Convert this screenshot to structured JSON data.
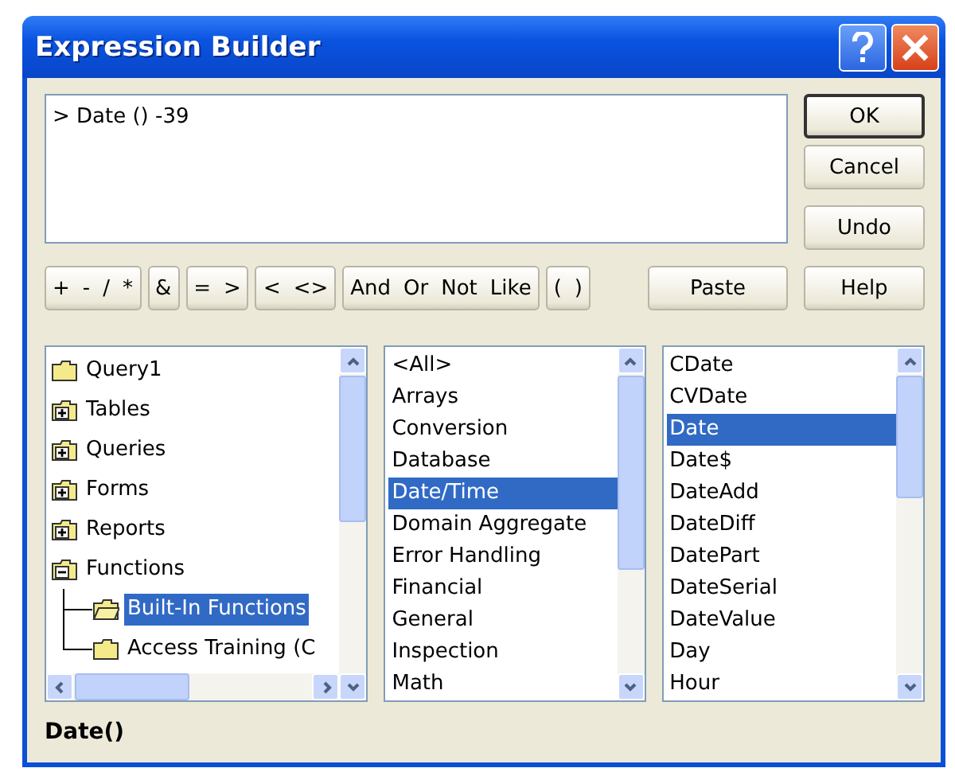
{
  "window": {
    "title": "Expression Builder"
  },
  "expression": "> Date () -39",
  "side_buttons": [
    {
      "label": "OK",
      "default": true
    },
    {
      "label": "Cancel",
      "default": false
    },
    {
      "label": "Undo",
      "default": false
    }
  ],
  "operator_groups": [
    [
      "+",
      "-",
      "/",
      "*"
    ],
    [
      "&"
    ],
    [
      "=",
      ">"
    ],
    [
      "<",
      "<>"
    ],
    [
      "And",
      "Or",
      "Not",
      "Like"
    ],
    [
      "(",
      ")"
    ]
  ],
  "paste_button": "Paste",
  "help_button": "Help",
  "tree": [
    {
      "label": "Query1",
      "selected": false
    },
    {
      "label": "Tables",
      "expanded": false,
      "selected": false
    },
    {
      "label": "Queries",
      "expanded": false,
      "selected": false
    },
    {
      "label": "Forms",
      "expanded": false,
      "selected": false
    },
    {
      "label": "Reports",
      "expanded": false,
      "selected": false
    },
    {
      "label": "Functions",
      "expanded": true,
      "selected": false,
      "children": [
        {
          "label": "Built-In Functions",
          "selected": true
        },
        {
          "label": "Access Training (C",
          "selected": false
        }
      ]
    }
  ],
  "categories": [
    {
      "label": "<All>",
      "selected": false
    },
    {
      "label": "Arrays",
      "selected": false
    },
    {
      "label": "Conversion",
      "selected": false
    },
    {
      "label": "Database",
      "selected": false
    },
    {
      "label": "Date/Time",
      "selected": true
    },
    {
      "label": "Domain Aggregate",
      "selected": false
    },
    {
      "label": "Error Handling",
      "selected": false
    },
    {
      "label": "Financial",
      "selected": false
    },
    {
      "label": "General",
      "selected": false
    },
    {
      "label": "Inspection",
      "selected": false
    },
    {
      "label": "Math",
      "selected": false
    }
  ],
  "functions": [
    {
      "label": "CDate",
      "selected": false
    },
    {
      "label": "CVDate",
      "selected": false
    },
    {
      "label": "Date",
      "selected": true
    },
    {
      "label": "Date$",
      "selected": false
    },
    {
      "label": "DateAdd",
      "selected": false
    },
    {
      "label": "DateDiff",
      "selected": false
    },
    {
      "label": "DatePart",
      "selected": false
    },
    {
      "label": "DateSerial",
      "selected": false
    },
    {
      "label": "DateValue",
      "selected": false
    },
    {
      "label": "Day",
      "selected": false
    },
    {
      "label": "Hour",
      "selected": false
    }
  ],
  "status": "Date()"
}
